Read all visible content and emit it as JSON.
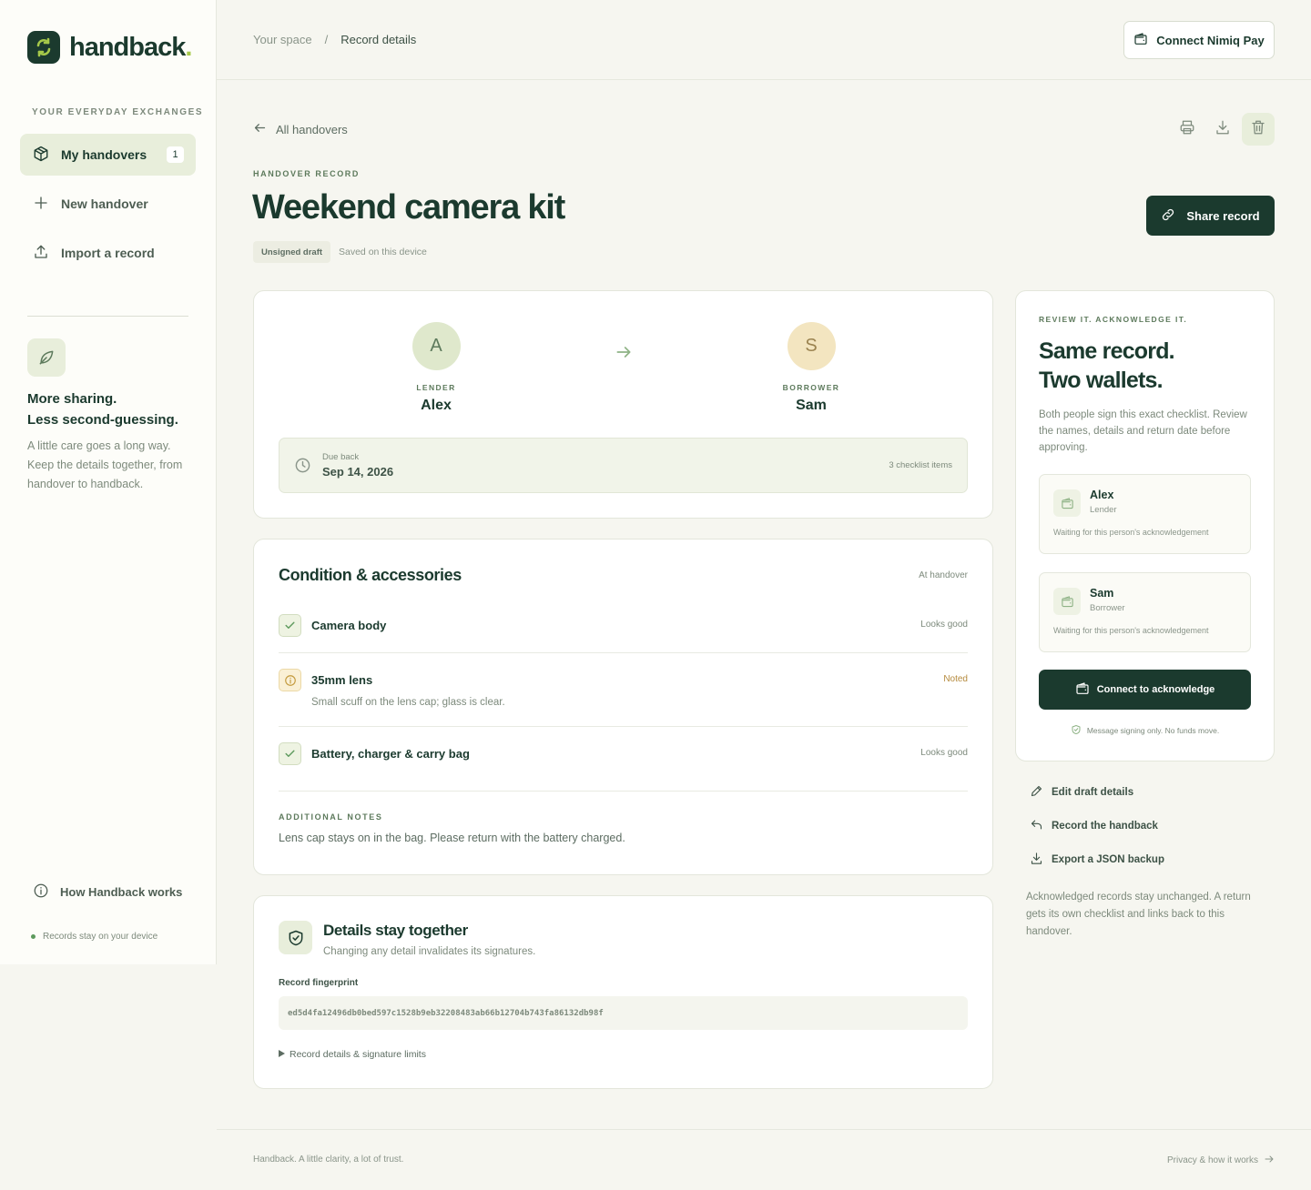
{
  "brand": {
    "name": "handback",
    "dot": ".",
    "accent": "#a6c94a",
    "primary": "#1b3a2e"
  },
  "sidebar": {
    "section_label": "YOUR EVERYDAY EXCHANGES",
    "items": [
      {
        "label": "My handovers",
        "icon": "box-icon",
        "badge": "1",
        "active": true
      },
      {
        "label": "New handover",
        "icon": "plus-icon"
      },
      {
        "label": "Import a record",
        "icon": "upload-icon"
      }
    ],
    "promo": {
      "icon": "leaf-icon",
      "heading_line1": "More sharing.",
      "heading_line2": "Less second-guessing.",
      "text": "A little care goes a long way. Keep the details together, from handover to handback."
    },
    "help_link": "How Handback works",
    "device_note": "Records stay on your device"
  },
  "topbar": {
    "breadcrumb": [
      "Your space",
      "/",
      "Record details"
    ],
    "connect_button": "Connect Nimiq Pay"
  },
  "header": {
    "back_link": "All handovers",
    "eyebrow": "HANDOVER RECORD",
    "title": "Weekend camera kit",
    "status_badge": "Unsigned draft",
    "saved_note": "Saved on this device",
    "share_button": "Share record",
    "tools": [
      "print-icon",
      "download-icon",
      "trash-icon"
    ]
  },
  "parties": {
    "lender": {
      "initial": "A",
      "role": "LENDER",
      "name": "Alex"
    },
    "borrower": {
      "initial": "S",
      "role": "BORROWER",
      "name": "Sam"
    },
    "due_label": "Due back",
    "due_date": "Sep 14, 2026",
    "checklist_count": "3 checklist items"
  },
  "condition": {
    "title": "Condition & accessories",
    "meta": "At handover",
    "items": [
      {
        "name": "Camera body",
        "status": "Looks good",
        "state": "ok",
        "note": ""
      },
      {
        "name": "35mm lens",
        "status": "Noted",
        "state": "warn",
        "note": "Small scuff on the lens cap; glass is clear."
      },
      {
        "name": "Battery, charger & carry bag",
        "status": "Looks good",
        "state": "ok",
        "note": ""
      }
    ],
    "notes_label": "ADDITIONAL NOTES",
    "notes_text": "Lens cap stays on in the bag. Please return with the battery charged."
  },
  "integrity": {
    "title": "Details stay together",
    "subtitle": "Changing any detail invalidates its signatures.",
    "fingerprint_label": "Record fingerprint",
    "fingerprint": "ed5d4fa12496db0bed597c1528b9eb32208483ab66b12704b743fa86132db98f",
    "details_toggle": "Record details & signature limits"
  },
  "review": {
    "eyebrow": "REVIEW IT. ACKNOWLEDGE IT.",
    "title_line1": "Same record.",
    "title_line2": "Two wallets.",
    "text": "Both people sign this exact checklist. Review the names, details and return date before approving.",
    "signers": [
      {
        "name": "Alex",
        "role": "Lender",
        "status": "Waiting for this person's acknowledgement"
      },
      {
        "name": "Sam",
        "role": "Borrower",
        "status": "Waiting for this person's acknowledgement"
      }
    ],
    "ack_button": "Connect to acknowledge",
    "ack_note": "Message signing only. No funds move."
  },
  "actions": [
    {
      "label": "Edit draft details",
      "icon": "pencil-icon"
    },
    {
      "label": "Record the handback",
      "icon": "undo-icon"
    },
    {
      "label": "Export a JSON backup",
      "icon": "download-icon"
    }
  ],
  "actions_footnote": "Acknowledged records stay unchanged. A return gets its own checklist and links back to this handover.",
  "footer": {
    "tagline": "Handback. A little clarity, a lot of trust.",
    "link": "Privacy & how it works"
  }
}
